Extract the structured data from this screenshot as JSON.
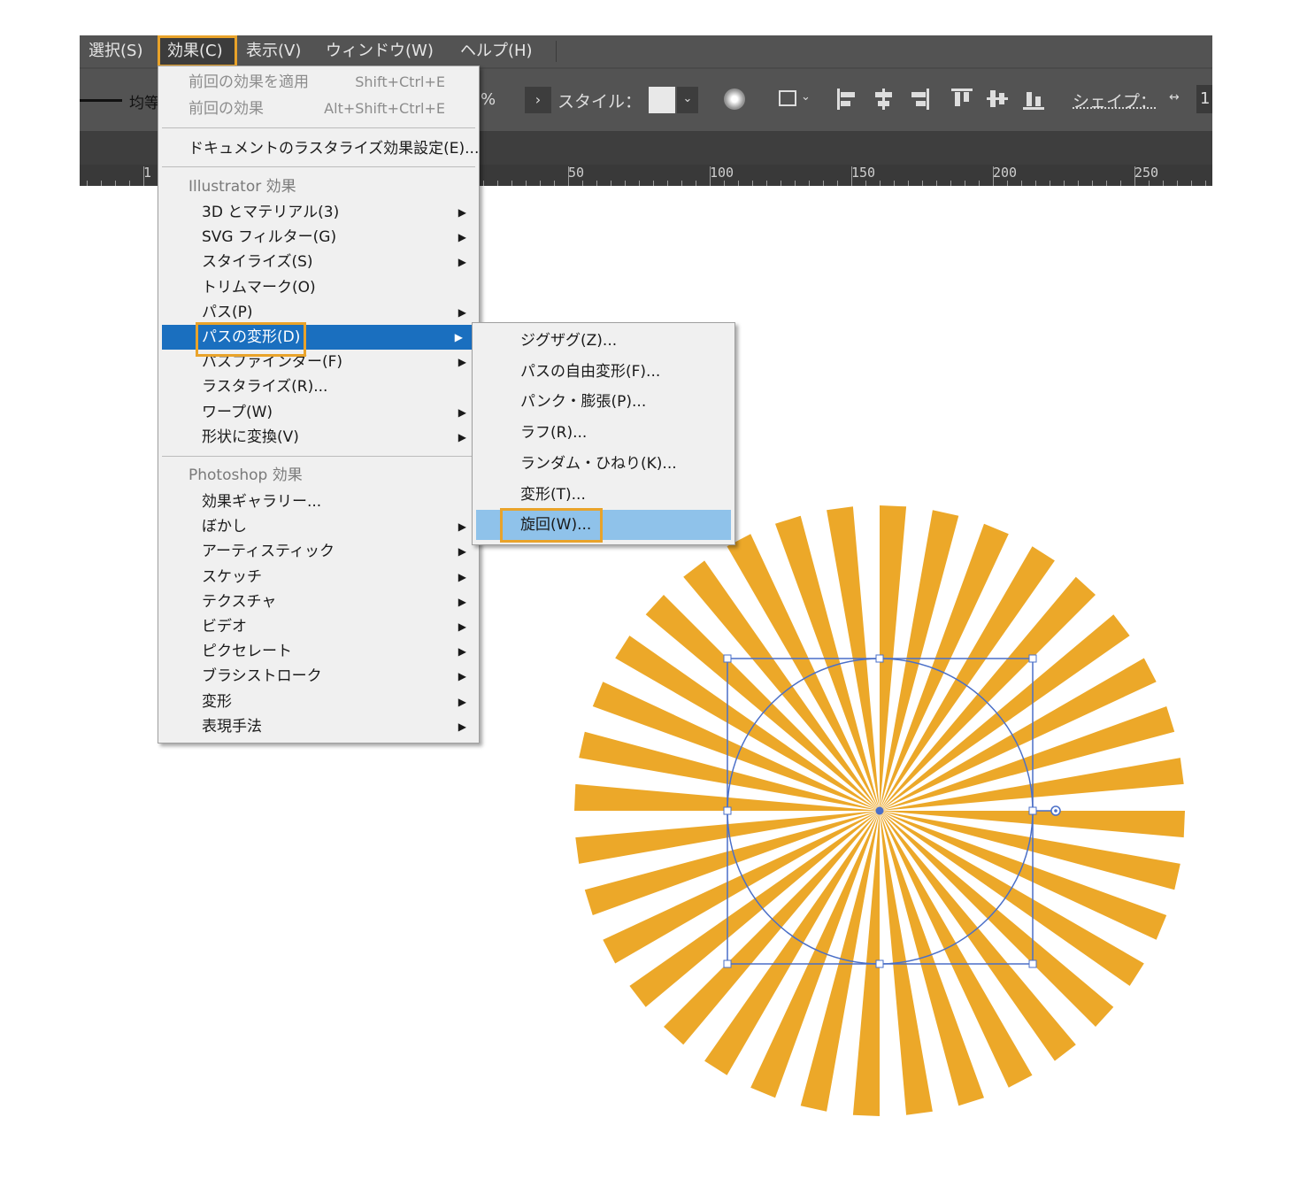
{
  "menubar": {
    "items": [
      "選択(S)",
      "効果(C)",
      "表示(V)",
      "ウィンドウ(W)",
      "ヘルプ(H)"
    ],
    "active_index": 1
  },
  "controlbar": {
    "stroke_label": "均等",
    "percent": "%",
    "style_label": "スタイル：",
    "shape_label": "シェイプ：",
    "shape_value": "1"
  },
  "ruler": {
    "labels": [
      "1",
      "50",
      "100",
      "150",
      "200",
      "250"
    ]
  },
  "effect_menu": {
    "apply_last": {
      "label": "前回の効果を適用",
      "shortcut": "Shift+Ctrl+E"
    },
    "last_effect": {
      "label": "前回の効果",
      "shortcut": "Alt+Shift+Ctrl+E"
    },
    "rasterize_settings": "ドキュメントのラスタライズ効果設定(E)...",
    "illustrator_header": "Illustrator 効果",
    "illustrator_items": [
      {
        "label": "3D とマテリアル(3)",
        "submenu": true
      },
      {
        "label": "SVG フィルター(G)",
        "submenu": true
      },
      {
        "label": "スタイライズ(S)",
        "submenu": true
      },
      {
        "label": "トリムマーク(O)",
        "submenu": false
      },
      {
        "label": "パス(P)",
        "submenu": true
      },
      {
        "label": "パスの変形(D)",
        "submenu": true
      },
      {
        "label": "パスファインダー(F)",
        "submenu": true
      },
      {
        "label": "ラスタライズ(R)...",
        "submenu": false
      },
      {
        "label": "ワープ(W)",
        "submenu": true
      },
      {
        "label": "形状に変換(V)",
        "submenu": true
      }
    ],
    "highlighted_index": 5,
    "photoshop_header": "Photoshop 効果",
    "photoshop_items": [
      {
        "label": "効果ギャラリー...",
        "submenu": false
      },
      {
        "label": "ぼかし",
        "submenu": true
      },
      {
        "label": "アーティスティック",
        "submenu": true
      },
      {
        "label": "スケッチ",
        "submenu": true
      },
      {
        "label": "テクスチャ",
        "submenu": true
      },
      {
        "label": "ビデオ",
        "submenu": true
      },
      {
        "label": "ピクセレート",
        "submenu": true
      },
      {
        "label": "ブラシストローク",
        "submenu": true
      },
      {
        "label": "変形",
        "submenu": true
      },
      {
        "label": "表現手法",
        "submenu": true
      }
    ]
  },
  "distort_submenu": {
    "items": [
      "ジグザグ(Z)...",
      "パスの自由変形(F)...",
      "パンク・膨張(P)...",
      "ラフ(R)...",
      "ランダム・ひねり(K)...",
      "変形(T)...",
      "旋回(W)..."
    ],
    "highlighted_index": 6
  },
  "artwork": {
    "ray_color": "#eca829",
    "selection_color": "#4a6fc8",
    "ray_count": 36
  },
  "colors": {
    "accent": "#e9a32a",
    "menu_highlight": "#1a6fbf",
    "submenu_highlight": "#8fc2ea"
  }
}
